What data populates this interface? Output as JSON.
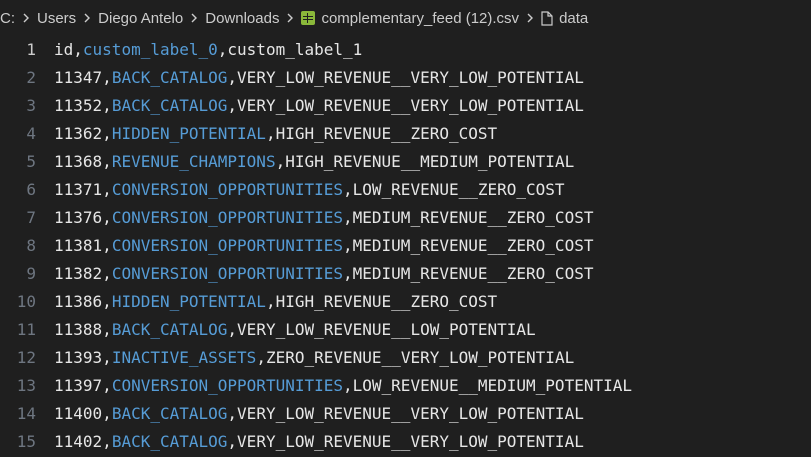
{
  "breadcrumb": {
    "items": [
      "C:",
      "Users",
      "Diego Antelo",
      "Downloads",
      "complementary_feed (12).csv",
      "data"
    ]
  },
  "editor": {
    "lines": [
      {
        "num": "1",
        "id": "id",
        "c1": "custom_label_0",
        "c2": "custom_label_1"
      },
      {
        "num": "2",
        "id": "11347",
        "c1": "BACK_CATALOG",
        "c2": "VERY_LOW_REVENUE__VERY_LOW_POTENTIAL"
      },
      {
        "num": "3",
        "id": "11352",
        "c1": "BACK_CATALOG",
        "c2": "VERY_LOW_REVENUE__VERY_LOW_POTENTIAL"
      },
      {
        "num": "4",
        "id": "11362",
        "c1": "HIDDEN_POTENTIAL",
        "c2": "HIGH_REVENUE__ZERO_COST"
      },
      {
        "num": "5",
        "id": "11368",
        "c1": "REVENUE_CHAMPIONS",
        "c2": "HIGH_REVENUE__MEDIUM_POTENTIAL"
      },
      {
        "num": "6",
        "id": "11371",
        "c1": "CONVERSION_OPPORTUNITIES",
        "c2": "LOW_REVENUE__ZERO_COST"
      },
      {
        "num": "7",
        "id": "11376",
        "c1": "CONVERSION_OPPORTUNITIES",
        "c2": "MEDIUM_REVENUE__ZERO_COST"
      },
      {
        "num": "8",
        "id": "11381",
        "c1": "CONVERSION_OPPORTUNITIES",
        "c2": "MEDIUM_REVENUE__ZERO_COST"
      },
      {
        "num": "9",
        "id": "11382",
        "c1": "CONVERSION_OPPORTUNITIES",
        "c2": "MEDIUM_REVENUE__ZERO_COST"
      },
      {
        "num": "10",
        "id": "11386",
        "c1": "HIDDEN_POTENTIAL",
        "c2": "HIGH_REVENUE__ZERO_COST"
      },
      {
        "num": "11",
        "id": "11388",
        "c1": "BACK_CATALOG",
        "c2": "VERY_LOW_REVENUE__LOW_POTENTIAL"
      },
      {
        "num": "12",
        "id": "11393",
        "c1": "INACTIVE_ASSETS",
        "c2": "ZERO_REVENUE__VERY_LOW_POTENTIAL"
      },
      {
        "num": "13",
        "id": "11397",
        "c1": "CONVERSION_OPPORTUNITIES",
        "c2": "LOW_REVENUE__MEDIUM_POTENTIAL"
      },
      {
        "num": "14",
        "id": "11400",
        "c1": "BACK_CATALOG",
        "c2": "VERY_LOW_REVENUE__VERY_LOW_POTENTIAL"
      },
      {
        "num": "15",
        "id": "11402",
        "c1": "BACK_CATALOG",
        "c2": "VERY_LOW_REVENUE__VERY_LOW_POTENTIAL"
      }
    ]
  },
  "colors": {
    "column0": "#e6e6e6",
    "column1": "#569cd6",
    "column2": "#e6e6e6",
    "csv_icon": "#8ab83a"
  },
  "icons": {
    "separator": "chevron-right-icon",
    "csv_file": "csv-file-icon",
    "symbol": "file-symbol-icon"
  }
}
